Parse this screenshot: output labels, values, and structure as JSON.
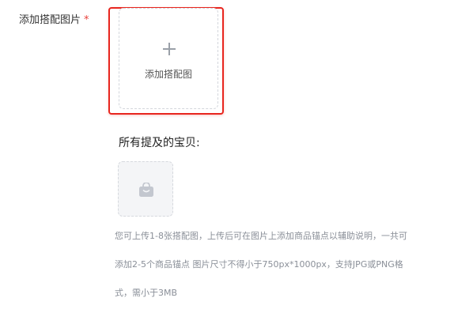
{
  "form": {
    "field_label": "添加搭配图片",
    "required_mark": "*",
    "upload_label": "添加搭配图",
    "products_heading": "所有提及的宝贝:",
    "hint_lines": [
      "您可上传1-8张搭配图，上传后可在图片上添加商品锚点以辅助说明，一共可",
      "添加2-5个商品锚点 图片尺寸不得小于750px*1000px，支持JPG或PNG格",
      "式，需小于3MB"
    ]
  },
  "icons": {
    "upload": "plus-icon",
    "product": "shopping-bag-icon"
  },
  "colors": {
    "highlight": "#e8261f",
    "required": "#e8403a",
    "hint_text": "#8a8f98",
    "icon_gray": "#c3c7cf"
  }
}
